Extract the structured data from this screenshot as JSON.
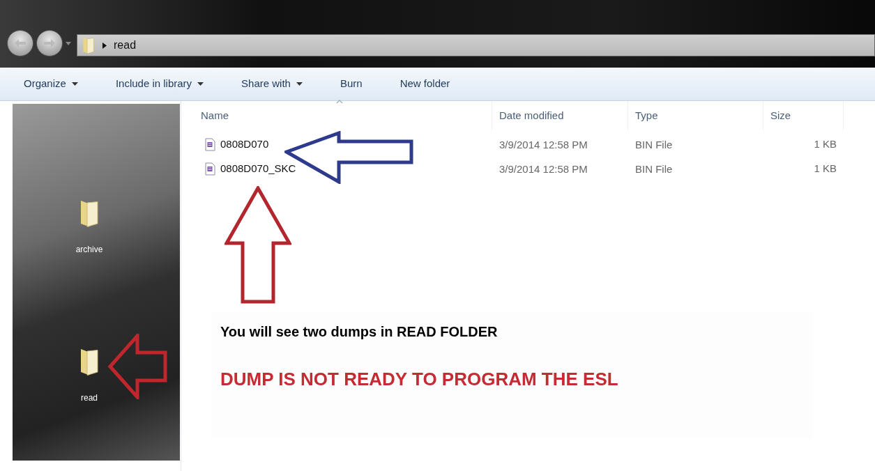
{
  "address_bar": {
    "path": [
      "read"
    ]
  },
  "toolbar": [
    {
      "label": "Organize",
      "has_menu": true
    },
    {
      "label": "Include in library",
      "has_menu": true
    },
    {
      "label": "Share with",
      "has_menu": true
    },
    {
      "label": "Burn",
      "has_menu": false
    },
    {
      "label": "New folder",
      "has_menu": false
    }
  ],
  "desktop_icons": [
    {
      "label": "archive"
    },
    {
      "label": "read"
    }
  ],
  "table": {
    "columns": [
      "Name",
      "Date modified",
      "Type",
      "Size"
    ],
    "rows": [
      {
        "name": "0808D070",
        "date": "3/9/2014 12:58 PM",
        "type": "BIN File",
        "size": "1 KB"
      },
      {
        "name": "0808D070_SKC",
        "date": "3/9/2014 12:58 PM",
        "type": "BIN File",
        "size": "1 KB"
      }
    ]
  },
  "annotations": {
    "note": "You will see two dumps in READ FOLDER",
    "warning": "DUMP IS NOT READY TO PROGRAM THE ESL"
  }
}
